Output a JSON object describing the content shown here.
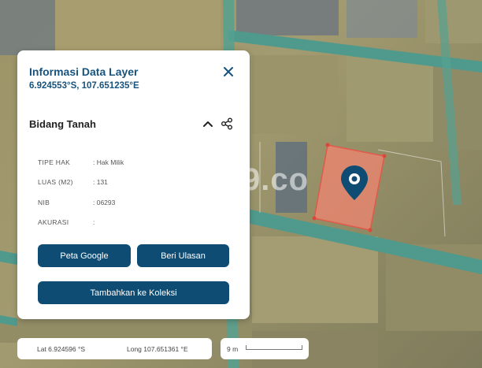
{
  "panel": {
    "title": "Informasi Data Layer",
    "coordinates": "6.924553°S, 107.651235°E",
    "section_title": "Bidang Tanah",
    "attributes": [
      {
        "label": "TIPE HAK",
        "value": ": Hak Milik"
      },
      {
        "label": "LUAS (M2)",
        "value": ": 131"
      },
      {
        "label": "NIB",
        "value": ": 06293"
      },
      {
        "label": "AKURASI",
        "value": ":"
      }
    ],
    "buttons": {
      "google": "Peta Google",
      "review": "Beri Ulasan",
      "add_collection": "Tambahkan ke Koleksi"
    }
  },
  "map": {
    "watermark": "9.co",
    "parcel_color": "#f08470",
    "marker_color": "#0f4c73",
    "road_color": "#4f9a8c"
  },
  "status_bar": {
    "lat": "Lat 6.924596 °S",
    "long": "Long 107.651361 °E",
    "scale": "9 m"
  },
  "colors": {
    "accent": "#17537e",
    "button": "#0f4c73"
  }
}
